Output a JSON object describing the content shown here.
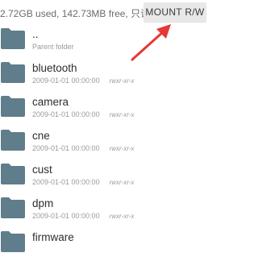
{
  "header": {
    "storage_text": "2.72GB used, 142.73MB free, 只读",
    "mount_button_label": "MOUNT R/W"
  },
  "colors": {
    "folder": "#607d8b",
    "annotation_arrow": "#e53935",
    "mount_button_bg": "#e8e8e8"
  },
  "items": [
    {
      "name": "..",
      "date": "Parent folder",
      "perms": ""
    },
    {
      "name": "bluetooth",
      "date": "2009-01-01 00:00:00",
      "perms": "rwxr-xr-x"
    },
    {
      "name": "camera",
      "date": "2009-01-01 00:00:00",
      "perms": "rwxr-xr-x"
    },
    {
      "name": "cne",
      "date": "2009-01-01 00:00:00",
      "perms": "rwxr-xr-x"
    },
    {
      "name": "cust",
      "date": "2009-01-01 00:00:00",
      "perms": "rwxr-xr-x"
    },
    {
      "name": "dpm",
      "date": "2009-01-01 00:00:00",
      "perms": "rwxr-xr-x"
    },
    {
      "name": "firmware",
      "date": "",
      "perms": ""
    }
  ]
}
